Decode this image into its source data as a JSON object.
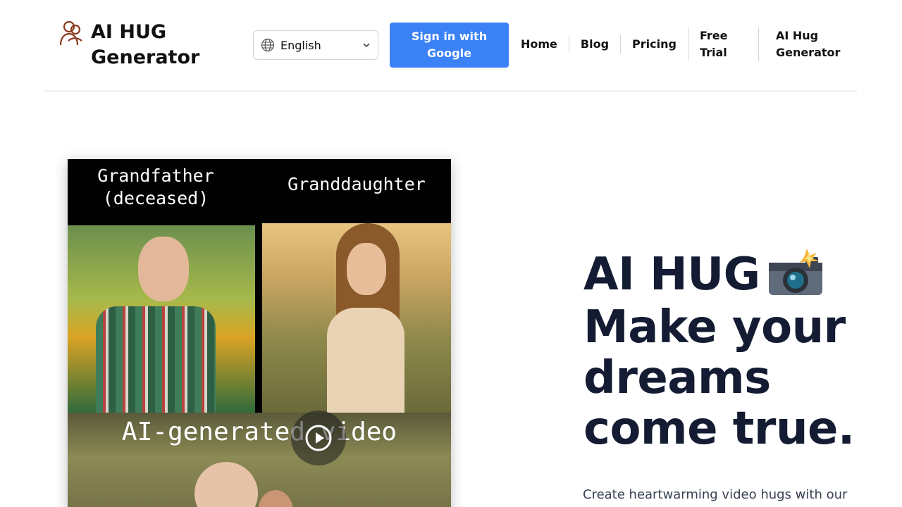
{
  "header": {
    "logo": {
      "icon": "hug-icon",
      "title": "AI HUG Generator"
    },
    "language_select": {
      "icon": "globe-icon",
      "value": "English",
      "chevron": "chevron-down-icon"
    },
    "signin_label": "Sign in with Google",
    "nav": [
      {
        "label": "Home"
      },
      {
        "label": "Blog"
      },
      {
        "label": "Pricing"
      },
      {
        "label": "Free Trial"
      },
      {
        "label": "AI Hug Generator"
      }
    ]
  },
  "media": {
    "caption_left": "Grandfather (deceased)",
    "caption_right": "Granddaughter",
    "caption_bottom": "AI-generated video",
    "play_icon": "play-icon"
  },
  "hero": {
    "title": "AI HUG",
    "title_emoji": "camera-flash-icon",
    "title_rest": "Make your dreams come true.",
    "subtitle": "Create heartwarming video hugs with our"
  },
  "colors": {
    "accent": "#3b82f6",
    "title": "#141c33",
    "logo_icon": "#8b3a1e"
  }
}
